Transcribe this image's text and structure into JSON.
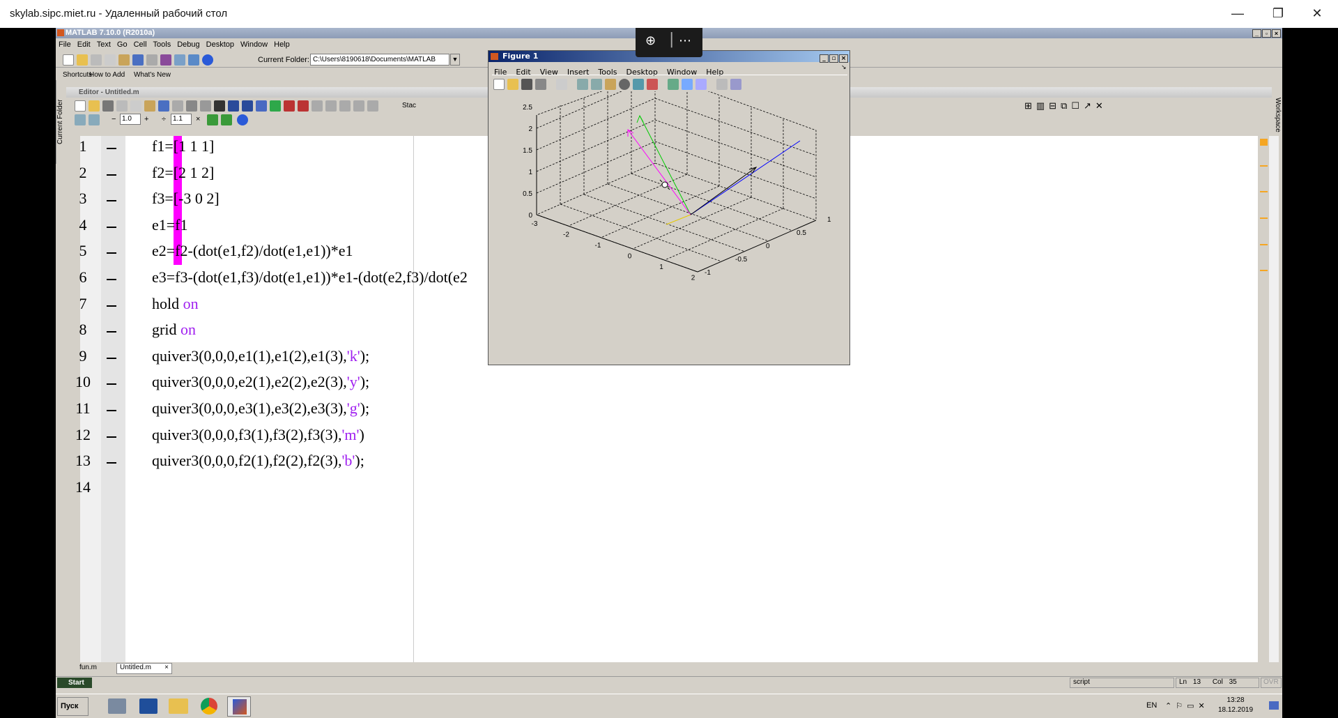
{
  "rdp": {
    "title": "skylab.sipc.miet.ru - Удаленный рабочий стол",
    "minimize": "—",
    "restore": "❐",
    "close": "✕"
  },
  "zoombar": {
    "zoom_icon": "magnifier-plus-icon",
    "more": "⋯"
  },
  "matlab": {
    "title": "MATLAB 7.10.0 (R2010a)",
    "menu": [
      "File",
      "Edit",
      "Text",
      "Go",
      "Cell",
      "Tools",
      "Debug",
      "Desktop",
      "Window",
      "Help"
    ],
    "current_folder_label": "Current Folder:",
    "current_folder_value": "C:\\Users\\8190618\\Documents\\MATLAB",
    "shortcuts": [
      "Shortcuts",
      "How to Add",
      "What's New"
    ],
    "editor_title": "Editor - Untitled.m",
    "cell_minus": "−",
    "cell_value1": "1.0",
    "cell_plus": "+",
    "cell_divide": "÷",
    "cell_value2": "1.1",
    "cell_times": "×",
    "stack_label": "Stac",
    "side_left": "Current Folder",
    "side_right": "Workspace"
  },
  "editor": {
    "lines": [
      {
        "n": "1",
        "code": [
          [
            "f1=[1 1 1]",
            ""
          ]
        ]
      },
      {
        "n": "2",
        "code": [
          [
            "f2=[2 1 2]",
            ""
          ]
        ]
      },
      {
        "n": "3",
        "code": [
          [
            "f3=[-3 0 2]",
            ""
          ]
        ]
      },
      {
        "n": "4",
        "code": [
          [
            "e1=f1",
            ""
          ]
        ]
      },
      {
        "n": "5",
        "code": [
          [
            "e2=f2-(dot(e1,f2)/dot(e1,e1))*e1",
            ""
          ]
        ]
      },
      {
        "n": "6",
        "code": [
          [
            "e3=f3-(dot(e1,f3)/dot(e1,e1))*e1-(dot(e2,f3)/dot(e2",
            ""
          ]
        ]
      },
      {
        "n": "7",
        "code": [
          [
            "hold ",
            ""
          ],
          [
            "on",
            "kw"
          ]
        ]
      },
      {
        "n": "8",
        "code": [
          [
            "grid ",
            ""
          ],
          [
            "on",
            "kw"
          ]
        ]
      },
      {
        "n": "9",
        "code": [
          [
            "quiver3(0,0,0,e1(1),e1(2),e1(3),",
            ""
          ],
          [
            "'k'",
            "str"
          ],
          [
            ");",
            ""
          ]
        ]
      },
      {
        "n": "10",
        "code": [
          [
            "quiver3(0,0,0,e2(1),e2(2),e2(3),",
            ""
          ],
          [
            "'y'",
            "str"
          ],
          [
            ");",
            ""
          ]
        ]
      },
      {
        "n": "11",
        "code": [
          [
            "quiver3(0,0,0,e3(1),e3(2),e3(3),",
            ""
          ],
          [
            "'g'",
            "str"
          ],
          [
            ");",
            ""
          ]
        ]
      },
      {
        "n": "12",
        "code": [
          [
            "quiver3(0,0,0,f3(1),f3(2),f3(3),",
            ""
          ],
          [
            "'m'",
            "str"
          ],
          [
            ")",
            ""
          ]
        ]
      },
      {
        "n": "13",
        "code": [
          [
            "quiver3(0,0,0,f2(1),f2(2),f2(3),",
            ""
          ],
          [
            "'b'",
            "str"
          ],
          [
            ");",
            ""
          ]
        ]
      },
      {
        "n": "14",
        "code": []
      }
    ],
    "tabs": [
      "fun.m",
      "Untitled.m"
    ],
    "tab_close": "×"
  },
  "figure": {
    "title": "Figure 1",
    "menu": [
      "File",
      "Edit",
      "View",
      "Insert",
      "Tools",
      "Desktop",
      "Window",
      "Help"
    ],
    "z_ticks": [
      "0",
      "0.5",
      "1",
      "1.5",
      "2",
      "2.5"
    ],
    "x_ticks": [
      "-3",
      "-2",
      "-1",
      "0",
      "1",
      "2"
    ],
    "y_ticks": [
      "-1",
      "-0.5",
      "0",
      "0.5",
      "1"
    ],
    "arrow_colors": {
      "e1": "#000000",
      "e2": "#e6c800",
      "e3": "#00cc00",
      "f3": "#ff00ff",
      "f2": "#0000ff"
    }
  },
  "statusbar": {
    "start": "Start",
    "mode": "script",
    "ln_label": "Ln",
    "ln": "13",
    "col_label": "Col",
    "col": "35",
    "ovr": "OVR"
  },
  "taskbar": {
    "start": "Пуск",
    "lang": "EN",
    "time": "13:28",
    "date": "18.12.2019"
  }
}
